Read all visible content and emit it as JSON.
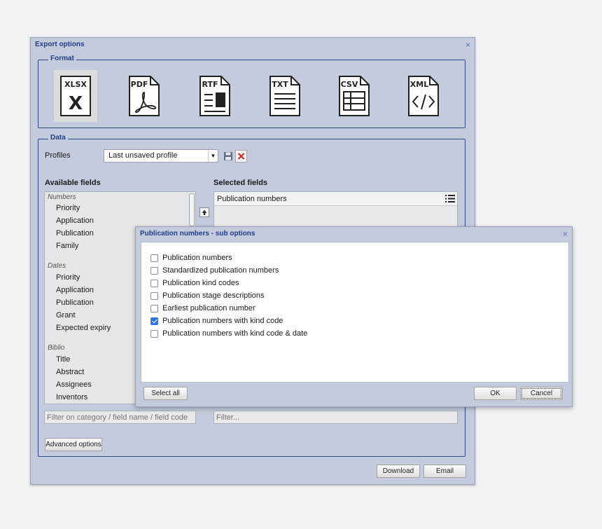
{
  "dialog": {
    "title": "Export options",
    "close_glyph": "×",
    "format_legend": "Format",
    "formats": [
      {
        "label": "XLSX",
        "icon": "xlsx-file-icon",
        "selected": true
      },
      {
        "label": "PDF",
        "icon": "pdf-file-icon",
        "selected": false
      },
      {
        "label": "RTF",
        "icon": "rtf-file-icon",
        "selected": false
      },
      {
        "label": "TXT",
        "icon": "txt-file-icon",
        "selected": false
      },
      {
        "label": "CSV",
        "icon": "csv-file-icon",
        "selected": false
      },
      {
        "label": "XML",
        "icon": "xml-file-icon",
        "selected": false
      }
    ],
    "data_legend": "Data",
    "profiles_label": "Profiles",
    "profile_value": "Last unsaved profile",
    "available_heading": "Available fields",
    "selected_heading": "Selected fields",
    "available": {
      "numbers_cat": "Numbers",
      "numbers": [
        "Priority",
        "Application",
        "Publication",
        "Family"
      ],
      "dates_cat": "Dates",
      "dates": [
        "Priority",
        "Application",
        "Publication",
        "Grant",
        "Expected expiry"
      ],
      "biblio_cat": "Biblio",
      "biblio": [
        "Title",
        "Abstract",
        "Assignees",
        "Inventors"
      ]
    },
    "selected_fields": [
      "Publication numbers"
    ],
    "filter_available_placeholder": "Filter on category / field name / field code",
    "filter_selected_placeholder": "Filter...",
    "advanced_button": "Advanced options",
    "download_button": "Download",
    "email_button": "Email"
  },
  "subdialog": {
    "title": "Publication numbers - sub options",
    "close_glyph": "×",
    "options": [
      {
        "label": "Publication numbers",
        "checked": false
      },
      {
        "label": "Standardized publication numbers",
        "checked": false
      },
      {
        "label": "Publication kind codes",
        "checked": false
      },
      {
        "label": "Publication stage descriptions",
        "checked": false
      },
      {
        "label": "Earliest publication number",
        "checked": false
      },
      {
        "label": "Publication numbers with kind code",
        "checked": true
      },
      {
        "label": "Publication numbers with kind code & date",
        "checked": false
      }
    ],
    "select_all_button": "Select all",
    "ok_button": "OK",
    "cancel_button": "Cancel"
  },
  "colors": {
    "title_text": "#1f3d8a",
    "dialog_bg": "#c3cbdc",
    "check_accent": "#2f77e0"
  }
}
